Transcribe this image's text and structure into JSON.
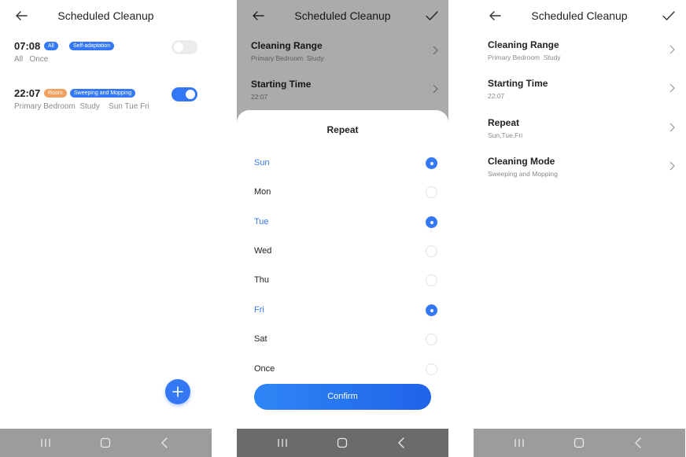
{
  "colors": {
    "accent": "#3478f6",
    "room_badge": "#f2a05f",
    "nav_bar": "#9c9c9c"
  },
  "screen1": {
    "title": "Scheduled Cleanup",
    "schedules": [
      {
        "time": "07:08",
        "badges": [
          {
            "text": "All",
            "color": "#3478f6"
          },
          {
            "text": "Self-adaptation",
            "color": "#3478f6"
          }
        ],
        "subtitle": "All   Once",
        "enabled": false
      },
      {
        "time": "22:07",
        "badges": [
          {
            "text": "Room",
            "color": "#f2a05f"
          },
          {
            "text": "Sweeping and Mopping",
            "color": "#3478f6"
          }
        ],
        "subtitle": "Primary Bedroom  Study    Sun Tue Fri",
        "enabled": true
      }
    ]
  },
  "screen2": {
    "title": "Scheduled Cleanup",
    "rows": [
      {
        "label": "Cleaning Range",
        "value": "Primary Bedroom  Study"
      },
      {
        "label": "Starting Time",
        "value": "22:07"
      }
    ],
    "sheet": {
      "title": "Repeat",
      "options": [
        {
          "label": "Sun",
          "selected": true
        },
        {
          "label": "Mon",
          "selected": false
        },
        {
          "label": "Tue",
          "selected": true
        },
        {
          "label": "Wed",
          "selected": false
        },
        {
          "label": "Thu",
          "selected": false
        },
        {
          "label": "Fri",
          "selected": true
        },
        {
          "label": "Sat",
          "selected": false
        },
        {
          "label": "Once",
          "selected": false
        }
      ],
      "confirm_label": "Confirm"
    }
  },
  "screen3": {
    "title": "Scheduled Cleanup",
    "rows": [
      {
        "label": "Cleaning Range",
        "value": "Primary Bedroom  Study"
      },
      {
        "label": "Starting Time",
        "value": "22:07"
      },
      {
        "label": "Repeat",
        "value": "Sun,Tue,Fri"
      },
      {
        "label": "Cleaning Mode",
        "value": "Sweeping and Mopping"
      }
    ]
  }
}
